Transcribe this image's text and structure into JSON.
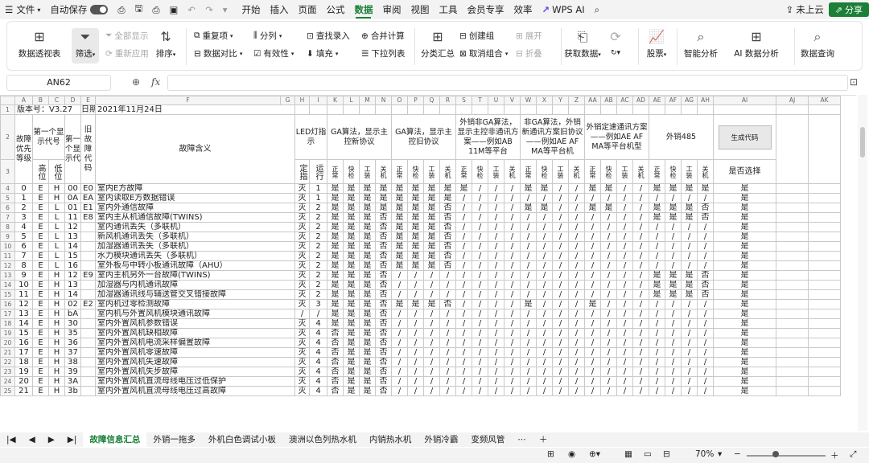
{
  "menubar": {
    "file": "文件",
    "autosave": "自动保存",
    "tabs": [
      "开始",
      "插入",
      "页面",
      "公式",
      "数据",
      "审阅",
      "视图",
      "工具",
      "会员专享",
      "效率"
    ],
    "active_tab": "数据",
    "wps_ai": "WPS AI",
    "cloud": "未上云",
    "share": "分享"
  },
  "ribbon": {
    "pivot": "数据透视表",
    "filter": "筛选",
    "show_all": "全部显示",
    "reapply": "重新应用",
    "sort": "排序",
    "dup": "重复项",
    "compare": "数据对比",
    "split": "分列",
    "validity": "有效性",
    "lookup": "查找录入",
    "fill": "填充",
    "merge_calc": "合并计算",
    "dropdown": "下拉列表",
    "subtotal": "分类汇总",
    "create_group": "创建组",
    "ungroup": "取消组合",
    "expand": "展开",
    "collapse": "折叠",
    "get_data": "获取数据",
    "stocks": "股票",
    "smart": "智能分析",
    "ai_analysis": "AI 数据分析",
    "query": "数据查询"
  },
  "formula_bar": {
    "cell": "AN62",
    "fx": "fx",
    "value": ""
  },
  "columns": [
    "A",
    "B",
    "C",
    "D",
    "E",
    "F",
    "G",
    "H",
    "I",
    "K",
    "L",
    "M",
    "N",
    "O",
    "P",
    "Q",
    "R",
    "S",
    "T",
    "U",
    "V",
    "W",
    "X",
    "Y",
    "Z",
    "AA",
    "AB",
    "AC",
    "AD",
    "AE",
    "AF",
    "AG",
    "AH",
    "AI",
    "AJ",
    "AK"
  ],
  "sheet": {
    "version_label": "版本号：V3.27",
    "date_label": "日期：",
    "date_value": "2021年11月24日",
    "headers": {
      "priority": "故障优先等级",
      "first_code": "第一个显示代号",
      "first_code_sub": [
        "高位",
        "低位"
      ],
      "second_code": "第一个显示代",
      "old_code": "旧故障代码",
      "meaning": "故障含义",
      "led": "LED灯指示",
      "led_sub": [
        "定指",
        "运行"
      ],
      "ga_new": "GA算法，显示主控新协议",
      "ga_old": "GA算法，显示主控旧协议",
      "export_non_ga": "外销非GA算法，显示主控非通讯方案——例如AB 11M等平台",
      "non_ga_export": "非GA算法，外销新通讯方案旧协议——例如AE AF MA等平台机",
      "export_fixed": "外销定速通讯方案——例如AE AF MA等平台机型",
      "export485": "外销485",
      "proto_sub": [
        "正常",
        "快检",
        "工装",
        "关机"
      ],
      "gen_code": "生成代码",
      "select": "是否选择"
    },
    "rows": [
      {
        "n": "4",
        "p": "0",
        "hi": "E",
        "lo": "H",
        "c": "00",
        "old": "E0",
        "m": "室内E方故障",
        "led": "灭",
        "run": "1",
        "v": [
          "是",
          "是",
          "是",
          "是",
          "是",
          "是",
          "是",
          "是",
          "是",
          "/",
          "/",
          "/",
          "是",
          "是",
          "/",
          "/",
          "是",
          "是",
          "/",
          "/",
          "是",
          "是",
          "是",
          "是"
        ],
        "sel": "是"
      },
      {
        "n": "5",
        "p": "1",
        "hi": "E",
        "lo": "H",
        "c": "0A",
        "old": "EA",
        "m": "室内读取E方数据错误",
        "led": "灭",
        "run": "1",
        "v": [
          "是",
          "是",
          "是",
          "是",
          "是",
          "是",
          "是",
          "是",
          "/",
          "/",
          "/",
          "/",
          "/",
          "/",
          "/",
          "/",
          "/",
          "/",
          "/",
          "/",
          "/",
          "/",
          "/",
          "/"
        ],
        "sel": "是"
      },
      {
        "n": "6",
        "p": "2",
        "hi": "E",
        "lo": "L",
        "c": "01",
        "old": "E1",
        "m": "室内外通信故障",
        "led": "灭",
        "run": "2",
        "v": [
          "是",
          "是",
          "是",
          "是",
          "是",
          "是",
          "是",
          "否",
          "/",
          "/",
          "/",
          "/",
          "是",
          "是",
          "/",
          "/",
          "是",
          "是",
          "/",
          "/",
          "是",
          "是",
          "是",
          "否"
        ],
        "sel": "是"
      },
      {
        "n": "7",
        "p": "3",
        "hi": "E",
        "lo": "L",
        "c": "11",
        "old": "E8",
        "m": "室内主从机通信故障(TWINS)",
        "led": "灭",
        "run": "2",
        "v": [
          "是",
          "是",
          "是",
          "否",
          "是",
          "是",
          "是",
          "否",
          "/",
          "/",
          "/",
          "/",
          "/",
          "/",
          "/",
          "/",
          "/",
          "/",
          "/",
          "/",
          "是",
          "是",
          "是",
          "否"
        ],
        "sel": "是"
      },
      {
        "n": "8",
        "p": "4",
        "hi": "E",
        "lo": "L",
        "c": "12",
        "old": "",
        "m": "室内通讯丢失（多联机）",
        "led": "灭",
        "run": "2",
        "v": [
          "是",
          "是",
          "是",
          "否",
          "是",
          "是",
          "是",
          "否",
          "/",
          "/",
          "/",
          "/",
          "/",
          "/",
          "/",
          "/",
          "/",
          "/",
          "/",
          "/",
          "/",
          "/",
          "/",
          "/"
        ],
        "sel": "是"
      },
      {
        "n": "9",
        "p": "5",
        "hi": "E",
        "lo": "L",
        "c": "13",
        "old": "",
        "m": "新风机通讯丢失（多联机）",
        "led": "灭",
        "run": "2",
        "v": [
          "是",
          "是",
          "是",
          "否",
          "是",
          "是",
          "是",
          "否",
          "/",
          "/",
          "/",
          "/",
          "/",
          "/",
          "/",
          "/",
          "/",
          "/",
          "/",
          "/",
          "/",
          "/",
          "/",
          "/"
        ],
        "sel": "是"
      },
      {
        "n": "10",
        "p": "6",
        "hi": "E",
        "lo": "L",
        "c": "14",
        "old": "",
        "m": "加湿器通讯丢失（多联机）",
        "led": "灭",
        "run": "2",
        "v": [
          "是",
          "是",
          "是",
          "否",
          "是",
          "是",
          "是",
          "否",
          "/",
          "/",
          "/",
          "/",
          "/",
          "/",
          "/",
          "/",
          "/",
          "/",
          "/",
          "/",
          "/",
          "/",
          "/",
          "/"
        ],
        "sel": "是"
      },
      {
        "n": "11",
        "p": "7",
        "hi": "E",
        "lo": "L",
        "c": "15",
        "old": "",
        "m": "水力模块通讯丢失（多联机）",
        "led": "灭",
        "run": "2",
        "v": [
          "是",
          "是",
          "是",
          "否",
          "是",
          "是",
          "是",
          "否",
          "/",
          "/",
          "/",
          "/",
          "/",
          "/",
          "/",
          "/",
          "/",
          "/",
          "/",
          "/",
          "/",
          "/",
          "/",
          "/"
        ],
        "sel": "是"
      },
      {
        "n": "12",
        "p": "8",
        "hi": "E",
        "lo": "L",
        "c": "16",
        "old": "",
        "m": "室外板与中转小板通讯故障（AHU）",
        "led": "灭",
        "run": "2",
        "v": [
          "是",
          "是",
          "是",
          "否",
          "是",
          "是",
          "是",
          "否",
          "/",
          "/",
          "/",
          "/",
          "/",
          "/",
          "/",
          "/",
          "/",
          "/",
          "/",
          "/",
          "/",
          "/",
          "/",
          "/"
        ],
        "sel": "是"
      },
      {
        "n": "13",
        "p": "9",
        "hi": "E",
        "lo": "H",
        "c": "12",
        "old": "E9",
        "m": "室内主机另外一台故障(TWINS)",
        "led": "灭",
        "run": "2",
        "v": [
          "是",
          "是",
          "是",
          "否",
          "/",
          "/",
          "/",
          "/",
          "/",
          "/",
          "/",
          "/",
          "/",
          "/",
          "/",
          "/",
          "/",
          "/",
          "/",
          "/",
          "是",
          "是",
          "是",
          "否"
        ],
        "sel": "是"
      },
      {
        "n": "14",
        "p": "10",
        "hi": "E",
        "lo": "H",
        "c": "13",
        "old": "",
        "m": "加湿器与内机通讯故障",
        "led": "灭",
        "run": "2",
        "v": [
          "是",
          "是",
          "是",
          "否",
          "/",
          "/",
          "/",
          "/",
          "/",
          "/",
          "/",
          "/",
          "/",
          "/",
          "/",
          "/",
          "/",
          "/",
          "/",
          "/",
          "是",
          "是",
          "是",
          "否"
        ],
        "sel": "是"
      },
      {
        "n": "15",
        "p": "11",
        "hi": "E",
        "lo": "H",
        "c": "14",
        "old": "",
        "m": "加湿器通讯线与辅送管交叉错接故障",
        "led": "灭",
        "run": "2",
        "v": [
          "是",
          "是",
          "是",
          "否",
          "/",
          "/",
          "/",
          "/",
          "/",
          "/",
          "/",
          "/",
          "/",
          "/",
          "/",
          "/",
          "/",
          "/",
          "/",
          "/",
          "是",
          "是",
          "是",
          "否"
        ],
        "sel": "是"
      },
      {
        "n": "16",
        "p": "12",
        "hi": "E",
        "lo": "H",
        "c": "02",
        "old": "E2",
        "m": "室内机过零检测故障",
        "led": "灭",
        "run": "3",
        "v": [
          "是",
          "是",
          "是",
          "否",
          "是",
          "是",
          "是",
          "否",
          "/",
          "/",
          "/",
          "/",
          "是",
          "/",
          "/",
          "/",
          "是",
          "/",
          "/",
          "/",
          "/",
          "/",
          "/",
          "/"
        ],
        "sel": "是"
      },
      {
        "n": "17",
        "p": "13",
        "hi": "E",
        "lo": "H",
        "c": "bA",
        "old": "",
        "m": "室内机与外置风机模块通讯故障",
        "led": "/",
        "run": "/",
        "v": [
          "是",
          "是",
          "是",
          "否",
          "/",
          "/",
          "/",
          "/",
          "/",
          "/",
          "/",
          "/",
          "/",
          "/",
          "/",
          "/",
          "/",
          "/",
          "/",
          "/",
          "/",
          "/",
          "/",
          "/"
        ],
        "sel": "是"
      },
      {
        "n": "18",
        "p": "14",
        "hi": "E",
        "lo": "H",
        "c": "30",
        "old": "",
        "m": "室内外置风机参数错误",
        "led": "灭",
        "run": "4",
        "v": [
          "是",
          "是",
          "是",
          "否",
          "/",
          "/",
          "/",
          "/",
          "/",
          "/",
          "/",
          "/",
          "/",
          "/",
          "/",
          "/",
          "/",
          "/",
          "/",
          "/",
          "/",
          "/",
          "/",
          "/"
        ],
        "sel": "是"
      },
      {
        "n": "19",
        "p": "15",
        "hi": "E",
        "lo": "H",
        "c": "35",
        "old": "",
        "m": "室内外置风机缺相故障",
        "led": "灭",
        "run": "4",
        "v": [
          "否",
          "是",
          "是",
          "否",
          "/",
          "/",
          "/",
          "/",
          "/",
          "/",
          "/",
          "/",
          "/",
          "/",
          "/",
          "/",
          "/",
          "/",
          "/",
          "/",
          "/",
          "/",
          "/",
          "/"
        ],
        "sel": "是"
      },
      {
        "n": "20",
        "p": "16",
        "hi": "E",
        "lo": "H",
        "c": "36",
        "old": "",
        "m": "室内外置风机电流采样偏置故障",
        "led": "灭",
        "run": "4",
        "v": [
          "否",
          "是",
          "是",
          "否",
          "/",
          "/",
          "/",
          "/",
          "/",
          "/",
          "/",
          "/",
          "/",
          "/",
          "/",
          "/",
          "/",
          "/",
          "/",
          "/",
          "/",
          "/",
          "/",
          "/"
        ],
        "sel": "是"
      },
      {
        "n": "21",
        "p": "17",
        "hi": "E",
        "lo": "H",
        "c": "37",
        "old": "",
        "m": "室内外置风机零速故障",
        "led": "灭",
        "run": "4",
        "v": [
          "否",
          "是",
          "是",
          "否",
          "/",
          "/",
          "/",
          "/",
          "/",
          "/",
          "/",
          "/",
          "/",
          "/",
          "/",
          "/",
          "/",
          "/",
          "/",
          "/",
          "/",
          "/",
          "/",
          "/"
        ],
        "sel": "是"
      },
      {
        "n": "22",
        "p": "18",
        "hi": "E",
        "lo": "H",
        "c": "38",
        "old": "",
        "m": "室内外置风机失速故障",
        "led": "灭",
        "run": "4",
        "v": [
          "否",
          "是",
          "是",
          "否",
          "/",
          "/",
          "/",
          "/",
          "/",
          "/",
          "/",
          "/",
          "/",
          "/",
          "/",
          "/",
          "/",
          "/",
          "/",
          "/",
          "/",
          "/",
          "/",
          "/"
        ],
        "sel": "是"
      },
      {
        "n": "23",
        "p": "19",
        "hi": "E",
        "lo": "H",
        "c": "39",
        "old": "",
        "m": "室内外置风机失步故障",
        "led": "灭",
        "run": "4",
        "v": [
          "否",
          "是",
          "是",
          "否",
          "/",
          "/",
          "/",
          "/",
          "/",
          "/",
          "/",
          "/",
          "/",
          "/",
          "/",
          "/",
          "/",
          "/",
          "/",
          "/",
          "/",
          "/",
          "/",
          "/"
        ],
        "sel": "是"
      },
      {
        "n": "24",
        "p": "20",
        "hi": "E",
        "lo": "H",
        "c": "3A",
        "old": "",
        "m": "室内外置风机直流母线电压过低保护",
        "led": "灭",
        "run": "4",
        "v": [
          "否",
          "是",
          "是",
          "否",
          "/",
          "/",
          "/",
          "/",
          "/",
          "/",
          "/",
          "/",
          "/",
          "/",
          "/",
          "/",
          "/",
          "/",
          "/",
          "/",
          "/",
          "/",
          "/",
          "/"
        ],
        "sel": "是"
      },
      {
        "n": "25",
        "p": "21",
        "hi": "E",
        "lo": "H",
        "c": "3b",
        "old": "",
        "m": "室内外置风机直流母线电压过高故障",
        "led": "灭",
        "run": "4",
        "v": [
          "否",
          "是",
          "是",
          "否",
          "/",
          "/",
          "/",
          "/",
          "/",
          "/",
          "/",
          "/",
          "/",
          "/",
          "/",
          "/",
          "/",
          "/",
          "/",
          "/",
          "/",
          "/",
          "/",
          "/"
        ],
        "sel": "是"
      }
    ]
  },
  "sheet_tabs": [
    "故障信息汇总",
    "外销一拖多",
    "外机白色调试小板",
    "澳洲以色列热水机",
    "内销热水机",
    "外销冷霸",
    "变频风管"
  ],
  "status": {
    "zoom": "70%"
  }
}
